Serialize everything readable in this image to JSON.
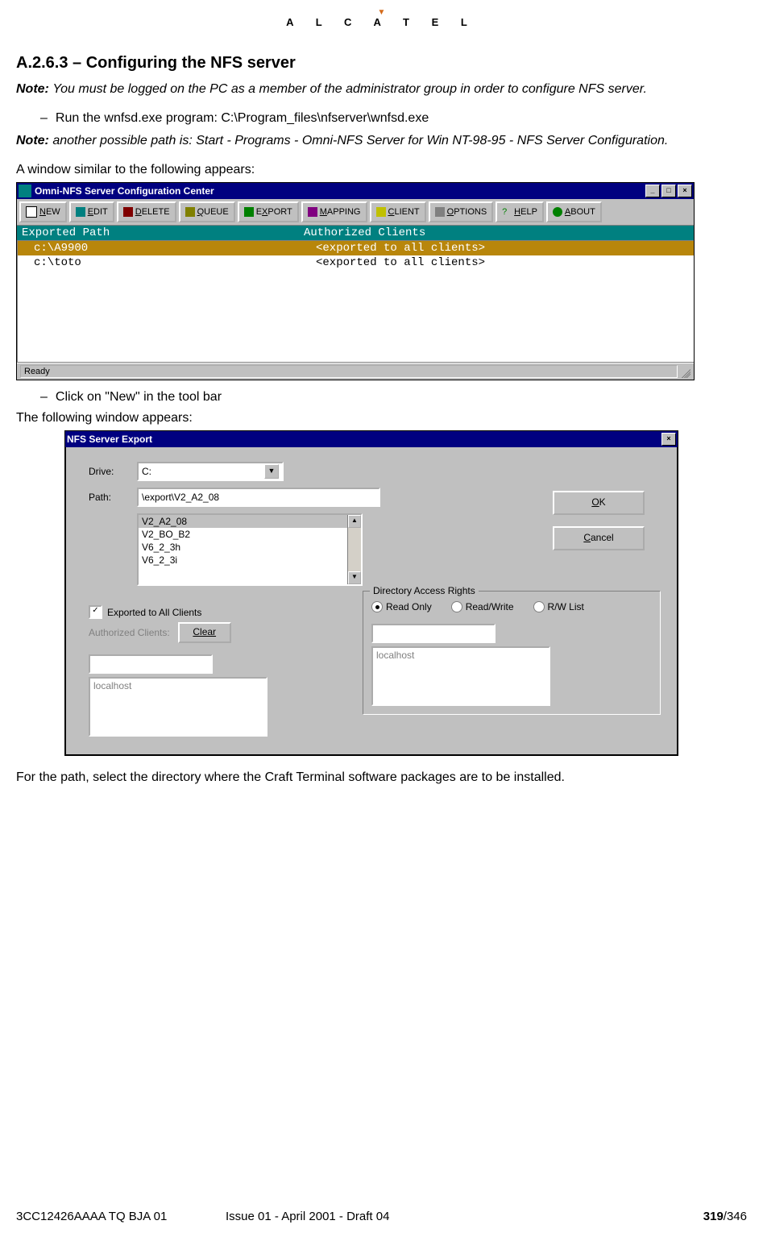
{
  "logo": "A L C A T E L",
  "heading": "A.2.6.3 – Configuring the NFS server",
  "note1_label": "Note:",
  "note1_body": "You must be logged on the PC as a member of the administrator group in order to configure NFS server.",
  "bullet1": "Run the wnfsd.exe program: C:\\Program_files\\nfserver\\wnfsd.exe",
  "note2_label": "Note:",
  "note2_body": "another possible path is: Start - Programs - Omni-NFS Server for Win NT-98-95 - NFS Server Configuration.",
  "intro1": "A window similar to the following appears:",
  "win1": {
    "title": "Omni-NFS Server Configuration Center",
    "toolbar": [
      "NEW",
      "EDIT",
      "DELETE",
      "QUEUE",
      "EXPORT",
      "MAPPING",
      "CLIENT",
      "OPTIONS",
      "HELP",
      "ABOUT"
    ],
    "hdr_path": "Exported Path",
    "hdr_clients": "Authorized Clients",
    "rows": [
      {
        "path": "c:\\A9900",
        "clients": "<exported to all clients>",
        "selected": true
      },
      {
        "path": "c:\\toto",
        "clients": "<exported to all clients>",
        "selected": false
      }
    ],
    "status": "Ready"
  },
  "bullet2": "Click on \"New\" in the tool bar",
  "intro2": "The following window appears:",
  "win2": {
    "title": "NFS Server Export",
    "drive_label": "Drive:",
    "drive_value": "C:",
    "path_label": "Path:",
    "path_value": "\\export\\V2_A2_08",
    "list": [
      "V2_A2_08",
      "V2_BO_B2",
      "V6_2_3h",
      "V6_2_3i"
    ],
    "ok": "OK",
    "cancel": "Cancel",
    "export_all": "Exported to All Clients",
    "auth_label": "Authorized   Clients:",
    "clear": "Clear",
    "localhost": "localhost",
    "group_title": "Directory Access Rights",
    "r1": "Read Only",
    "r2": "Read/Write",
    "r3": "R/W List"
  },
  "outro": "For the path, select the directory where the Craft Terminal software packages are to be installed.",
  "footer": {
    "left": "3CC12426AAAA TQ BJA 01",
    "center": "Issue 01 - April 2001 - Draft 04",
    "right_a": "319",
    "right_b": "/346"
  }
}
